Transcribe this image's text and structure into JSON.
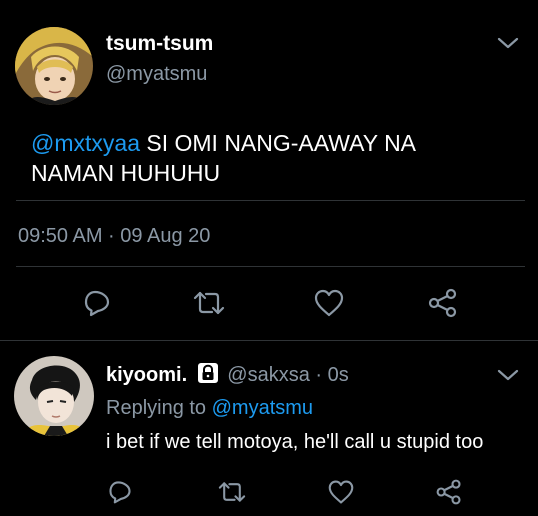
{
  "main_tweet": {
    "display_name": "tsum-tsum",
    "handle": "@myatsmu",
    "mention": "@mxtxyaa",
    "text_line1": " SI OMI NANG-AAWAY NA",
    "text_line2": "NAMAN HUHUHU",
    "timestamp": "09:50 AM · 09 Aug 20"
  },
  "reply": {
    "display_name": "kiyoomi.",
    "handle_time": "@sakxsa · 0s",
    "replying_prefix": "Replying to ",
    "replying_to": "@myatsmu",
    "text": "i bet if we tell motoya, he'll call u stupid too"
  },
  "icons": {
    "menu": "chevron-down-icon",
    "reply": "comment-bubble-icon",
    "retweet": "retweet-icon",
    "like": "heart-icon",
    "share": "share-icon",
    "protected": "lock-icon"
  },
  "colors": {
    "background": "#000000",
    "text": "#ffffff",
    "secondary_text": "#8b98a5",
    "accent_link": "#1d9bf0",
    "divider": "#2f3336"
  }
}
